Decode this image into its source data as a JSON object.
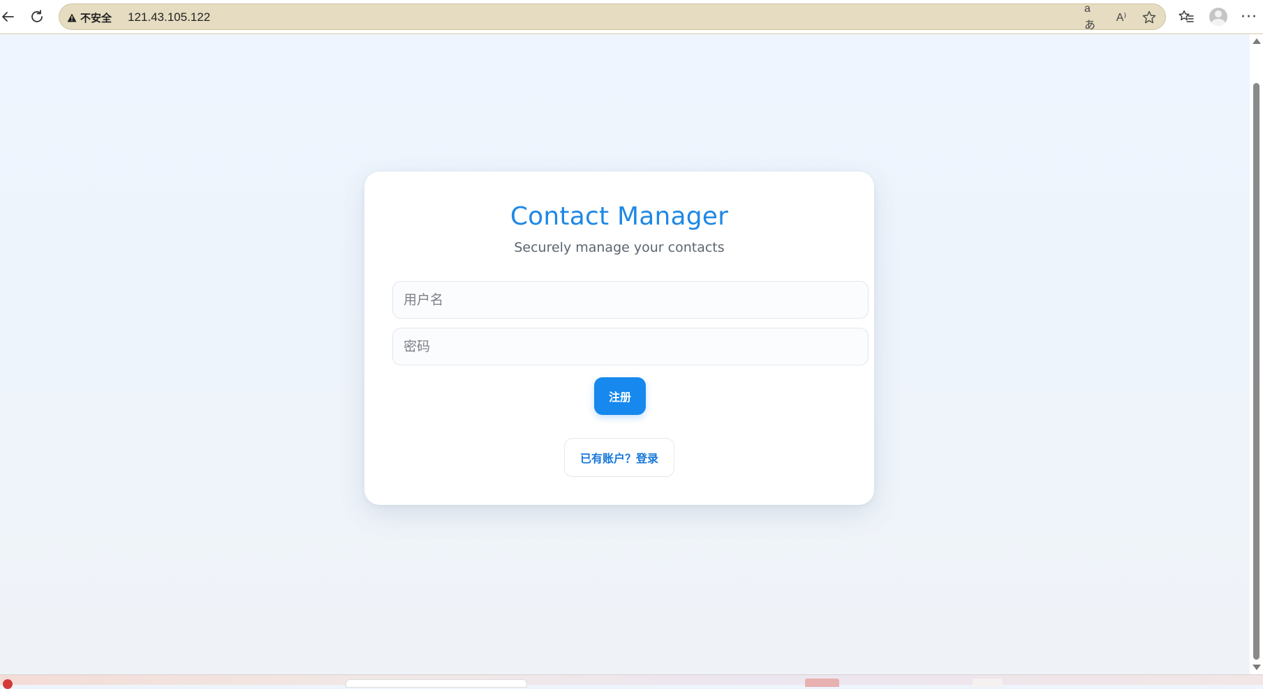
{
  "browser": {
    "security_label": "不安全",
    "url": "121.43.105.122",
    "icons": {
      "back": "back-arrow-icon",
      "reload": "reload-icon",
      "warning": "warning-icon",
      "translate": "translate-icon",
      "read_aloud": "read-aloud-icon",
      "favorite": "star-icon",
      "favorites": "favorites-icon",
      "profile": "profile-icon",
      "more": "more-icon"
    },
    "translate_glyph": "aあ",
    "read_aloud_glyph": "A⁾",
    "more_glyph": "···"
  },
  "login": {
    "title": "Contact Manager",
    "subtitle": "Securely manage your contacts",
    "username_placeholder": "用户名",
    "password_placeholder": "密码",
    "register_label": "注册",
    "login_link_label": "已有账户？登录"
  },
  "colors": {
    "accent": "#1e88e5",
    "button": "#1688ee",
    "page_bg": "#eef4fb",
    "address_bar": "#e5dcc1"
  }
}
